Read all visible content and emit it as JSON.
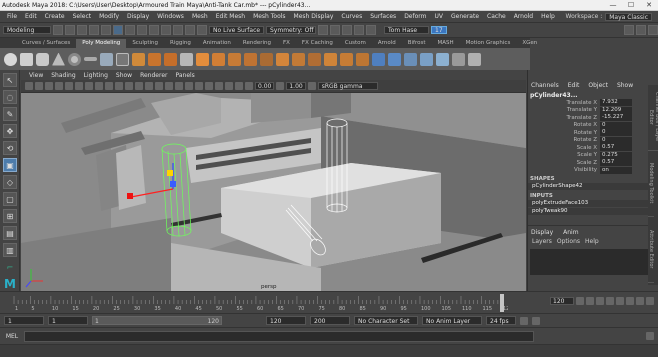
{
  "title_bar": {
    "text": "Autodesk Maya 2018: C:\\Users\\User\\Desktop\\Armoured Train Maya\\Anti-Tank Car.mb* --- pCylinder43...",
    "min": "—",
    "max": "☐",
    "close": "✕"
  },
  "menu": {
    "items": [
      "File",
      "Edit",
      "Create",
      "Select",
      "Modify",
      "Display",
      "Windows",
      "Mesh",
      "Edit Mesh",
      "Mesh Tools",
      "Mesh Display",
      "Curves",
      "Surfaces",
      "Deform",
      "UV",
      "Generate",
      "Cache",
      "Arnold",
      "Help"
    ],
    "workspace_label": "Workspace :",
    "workspace_value": "Maya Classic"
  },
  "status_line": {
    "mode": "Modeling",
    "live_surface": "No Live Surface",
    "symmetry": "Symmetry: Off",
    "user": "Tom Hase",
    "notifications": "17"
  },
  "shelf_tabs": [
    "Curves / Surfaces",
    "Poly Modeling",
    "Sculpting",
    "Rigging",
    "Animation",
    "Rendering",
    "FX",
    "FX Caching",
    "Custom",
    "Arnold",
    "Bifrost",
    "MASH",
    "Motion Graphics",
    "XGen"
  ],
  "shelf_active": "Poly Modeling",
  "panel_menu": [
    "View",
    "Shading",
    "Lighting",
    "Show",
    "Renderer",
    "Panels"
  ],
  "panel_toolbar": {
    "field1": "0.00",
    "field2": "1.00",
    "color_space": "sRGB gamma"
  },
  "viewport": {
    "camera_label": "persp"
  },
  "channel_box": {
    "tabs": [
      "Channels",
      "Edit",
      "Object",
      "Show"
    ],
    "object_name": "pCylinder43...",
    "attributes": [
      {
        "name": "Translate X",
        "value": "7.932"
      },
      {
        "name": "Translate Y",
        "value": "12.209"
      },
      {
        "name": "Translate Z",
        "value": "-15.227"
      },
      {
        "name": "Rotate X",
        "value": "0"
      },
      {
        "name": "Rotate Y",
        "value": "0"
      },
      {
        "name": "Rotate Z",
        "value": "0"
      },
      {
        "name": "Scale X",
        "value": "0.57"
      },
      {
        "name": "Scale Y",
        "value": "0.275"
      },
      {
        "name": "Scale Z",
        "value": "0.57"
      },
      {
        "name": "Visibility",
        "value": "on"
      }
    ],
    "shapes_header": "SHAPES",
    "shapes": [
      "pCylinderShape42"
    ],
    "inputs_header": "INPUTS",
    "inputs": [
      "polyExtrudeFace103",
      "polyTweak90"
    ]
  },
  "layer_editor": {
    "tabs": [
      "Display",
      "Anim"
    ],
    "menu": [
      "Layers",
      "Options",
      "Help"
    ]
  },
  "side_tabs": [
    "Channel Box / Layer Editor",
    "Modeling Toolkit",
    "Attribute Editor"
  ],
  "time_slider": {
    "ticks": [
      "1",
      "5",
      "10",
      "15",
      "20",
      "25",
      "30",
      "35",
      "40",
      "45",
      "50",
      "55",
      "60",
      "65",
      "70",
      "75",
      "80",
      "85",
      "90",
      "95",
      "100",
      "105",
      "110",
      "115",
      "120"
    ],
    "current_frame": "120"
  },
  "range_bar": {
    "start": "1",
    "playback_start": "1",
    "range_start_label": "1",
    "range_end_label": "120",
    "playback_end": "120",
    "end": "200",
    "char_set": "No Character Set",
    "anim_layer": "No Anim Layer",
    "fps": "24 fps"
  },
  "command_line": {
    "label": "MEL"
  }
}
